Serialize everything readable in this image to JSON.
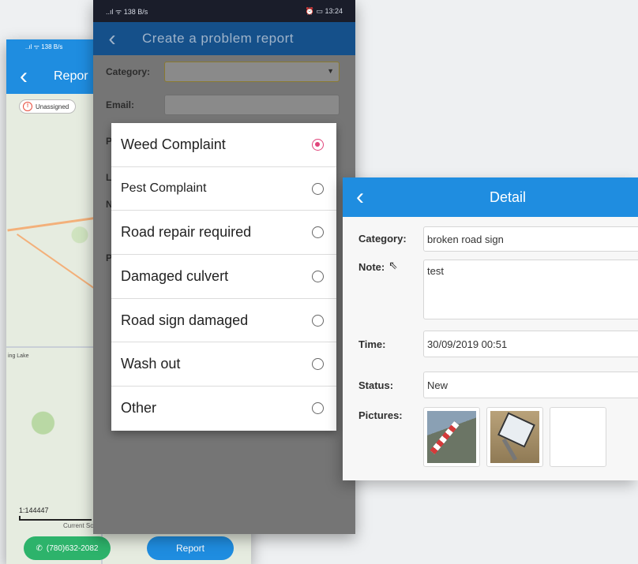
{
  "map_screen": {
    "status_text": "..ıl ᯤ 138 B/s",
    "title": "Repor",
    "legend": [
      "Unassigned"
    ],
    "place_label": "ing Lake",
    "scale": "1:144447",
    "scale_caption": "Current Sc",
    "phone_button": "(780)632-2082",
    "report_button": "Report"
  },
  "report_screen": {
    "status_left": "..ıl ᯤ 138 B/s",
    "status_right": "⏰ ▭ 13:24",
    "title": "Create a problem report",
    "category_label": "Category:",
    "email_label": "Email:",
    "hidden_labels": [
      "P",
      "L",
      "N",
      "P"
    ]
  },
  "dropdown": {
    "options": [
      {
        "label": "Weed Complaint",
        "selected": true
      },
      {
        "label": "Pest Complaint",
        "selected": false
      },
      {
        "label": "Road repair required",
        "selected": false
      },
      {
        "label": "Damaged culvert",
        "selected": false
      },
      {
        "label": "Road sign damaged",
        "selected": false
      },
      {
        "label": "Wash out",
        "selected": false
      },
      {
        "label": "Other",
        "selected": false
      }
    ]
  },
  "detail_screen": {
    "title": "Detail",
    "category_label": "Category:",
    "category_value": "broken road sign",
    "note_label": "Note:",
    "note_value": "test",
    "time_label": "Time:",
    "time_value": "30/09/2019 00:51",
    "status_label": "Status:",
    "status_value": "New",
    "pictures_label": "Pictures:"
  },
  "colors": {
    "primary_blue": "#1f8de0",
    "dark_header": "#15508a",
    "radio_selected": "#e0457b",
    "phone_green": "#2db36b"
  }
}
